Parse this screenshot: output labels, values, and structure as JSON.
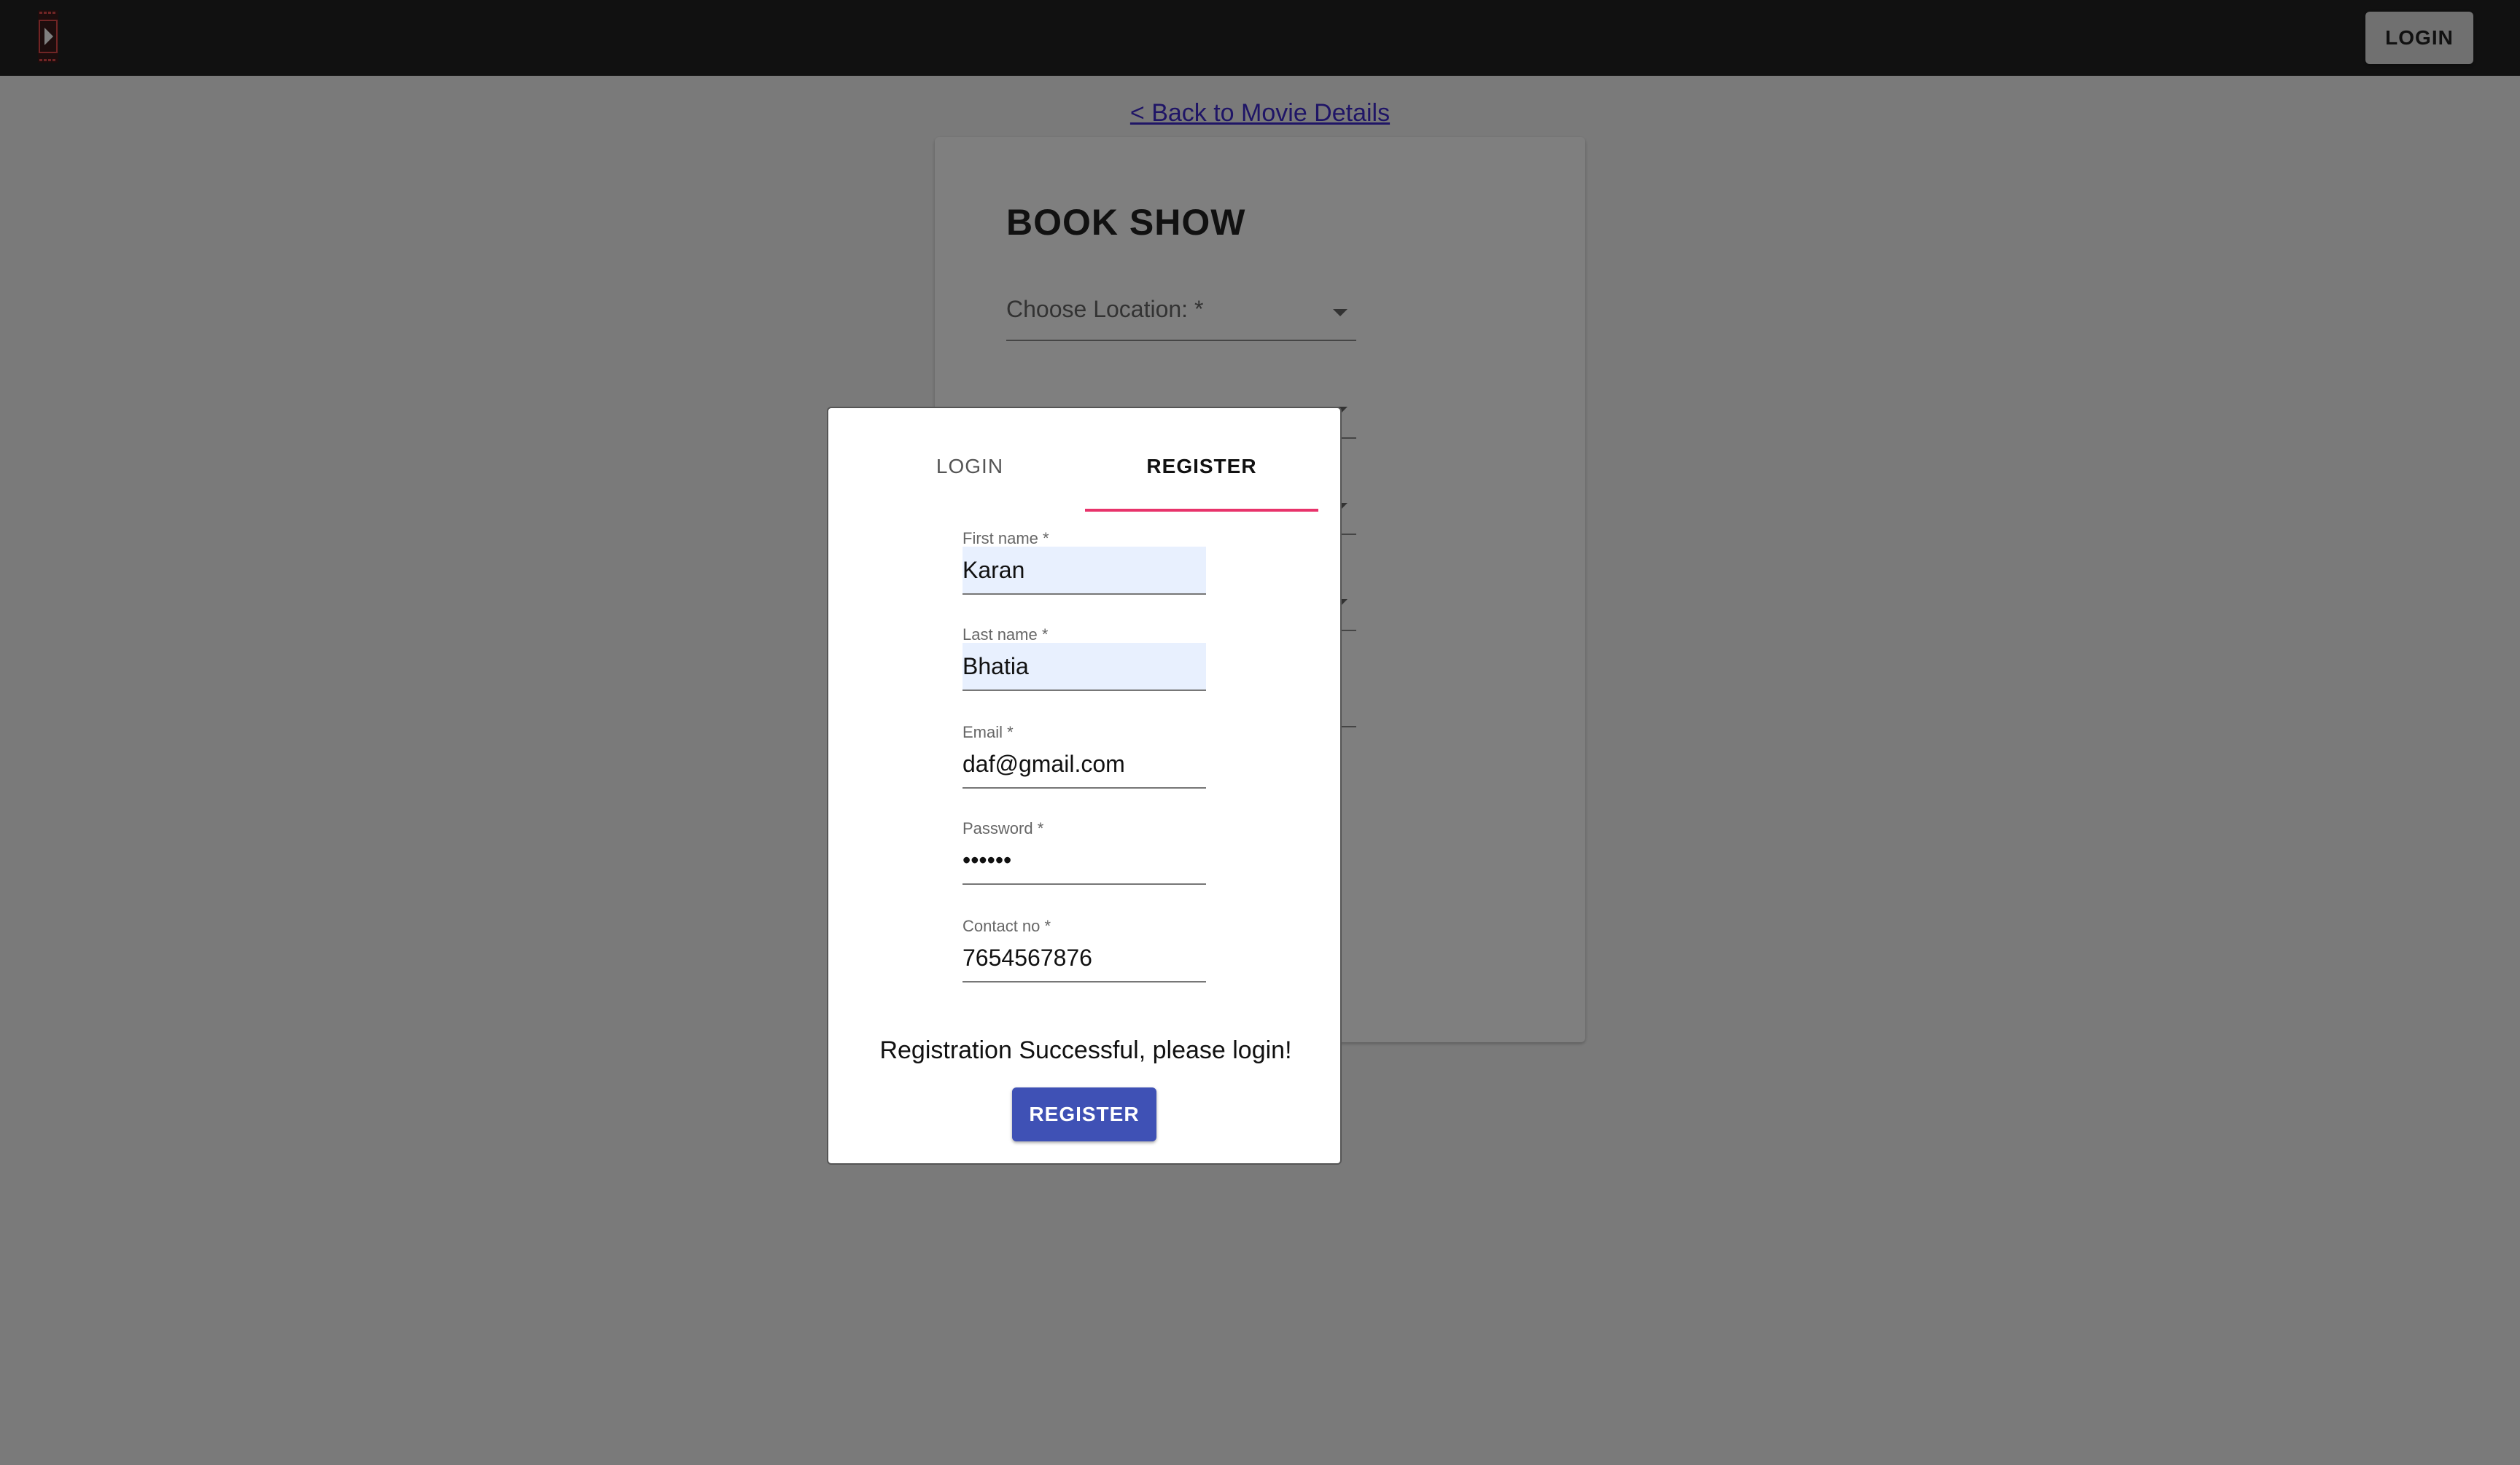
{
  "header": {
    "login_label": "LOGIN"
  },
  "back_link": "< Back to Movie Details",
  "book_show": {
    "title": "BOOK SHOW",
    "location_label": "Choose Location: *"
  },
  "modal": {
    "tabs": [
      {
        "label": "LOGIN",
        "active": false
      },
      {
        "label": "REGISTER",
        "active": true
      }
    ],
    "fields": [
      {
        "label": "First name *",
        "value": "Karan"
      },
      {
        "label": "Last name *",
        "value": "Bhatia"
      },
      {
        "label": "Email *",
        "value": "daf@gmail.com"
      },
      {
        "label": "Password *",
        "value": "••••••"
      },
      {
        "label": "Contact no *",
        "value": "7654567876"
      }
    ],
    "success_message": "Registration Successful, please login!",
    "register_label": "REGISTER"
  },
  "colors": {
    "header_bg": "#222222",
    "tab_indicator": "#e8336b",
    "register_button": "#3f51b5",
    "link": "#3f2bcc"
  }
}
